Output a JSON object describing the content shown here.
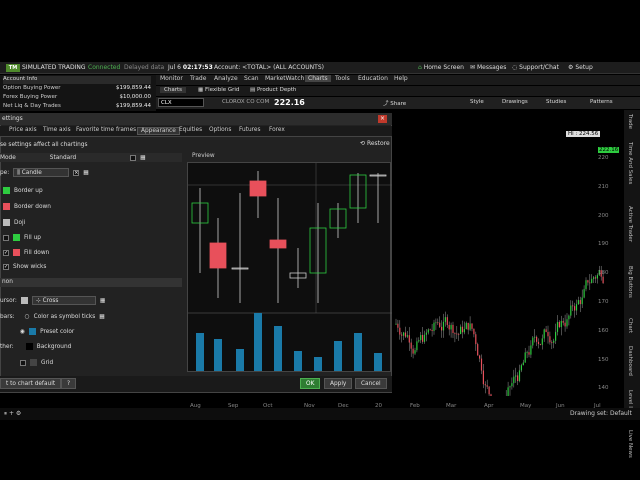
{
  "status": {
    "logo": "TM",
    "mode": "SIMULATED TRADING",
    "connection": "Connected",
    "delayed": "Delayed data",
    "date": "Jul 6",
    "time": "02:17:53",
    "account": "Account: <TOTAL> (ALL ACCOUNTS)",
    "home": "Home Screen",
    "messages": "Messages",
    "support": "Support/Chat",
    "setup": "Setup"
  },
  "menu": [
    "Monitor",
    "Trade",
    "Analyze",
    "Scan",
    "MarketWatch",
    "Charts",
    "Tools",
    "Education",
    "Help"
  ],
  "menu_active": "Charts",
  "left_panel": {
    "header": "Account Info",
    "rows": [
      {
        "label": "Option Buying Power",
        "value": "$199,859.44"
      },
      {
        "label": "Forex Buying Power",
        "value": "$10,000.00"
      },
      {
        "label": "Net Liq & Day Trades",
        "value": "$199,859.44"
      }
    ]
  },
  "chart_tabs": [
    "Charts",
    "Flexible Grid",
    "Product Depth"
  ],
  "chart_toolbar": {
    "symbol": "CLX",
    "company": "CLOROX CO COM",
    "price": "222.16",
    "share": "Share",
    "style": "Style",
    "drawings": "Drawings",
    "studies": "Studies",
    "patterns": "Patterns"
  },
  "dialog": {
    "title": "ettings",
    "tabs": [
      "Price axis",
      "Time axis",
      "Favorite time frames",
      "Appearance",
      "Equities",
      "Options",
      "Futures",
      "Forex"
    ],
    "active_tab": "Appearance",
    "restore": "Restore",
    "general_text": "se settings affect all chartings",
    "mode_label": "Mode",
    "mode_value": "Standard",
    "type_label": "pe:",
    "type_value": "Candle",
    "items": [
      {
        "label": "Border up",
        "color": "#2ecc40"
      },
      {
        "label": "Border down",
        "color": "#e8505b"
      },
      {
        "label": "Doji",
        "color": "#bbbbbb"
      },
      {
        "label": "Fill up",
        "color": "#2ecc40"
      },
      {
        "label": "Fill down",
        "color": "#e8505b"
      }
    ],
    "show_wicks": "Show wicks",
    "section": "non",
    "cursor_label": "ursor:",
    "cursor_value": "Cross",
    "bars_label": "bars:",
    "bars_opt1": "Color as symbol ticks",
    "bars_opt2": "Preset color",
    "other_label": "ther:",
    "background": "Background",
    "grid": "Grid",
    "preview_label": "Preview",
    "reset": "t to chart default",
    "ok": "OK",
    "apply": "Apply",
    "cancel": "Cancel"
  },
  "chart": {
    "last_price": "222.16",
    "hi_label": "Hi : 224.56",
    "y_labels": [
      "220",
      "210",
      "200",
      "190",
      "180",
      "170",
      "160",
      "150",
      "140"
    ],
    "x_labels_left": [
      "Aug",
      "Sep",
      "Oct",
      "Nov",
      "Dec",
      "20"
    ],
    "x_labels_right": [
      "Feb",
      "Mar",
      "Apr",
      "May",
      "Jun",
      "Jul"
    ],
    "drawing_set": "Drawing set: Default"
  },
  "right_tabs": [
    "Trade",
    "Time And Sales",
    "Active Trader",
    "Big Buttons",
    "Chart",
    "Dashboard",
    "Level II",
    "Live News"
  ]
}
